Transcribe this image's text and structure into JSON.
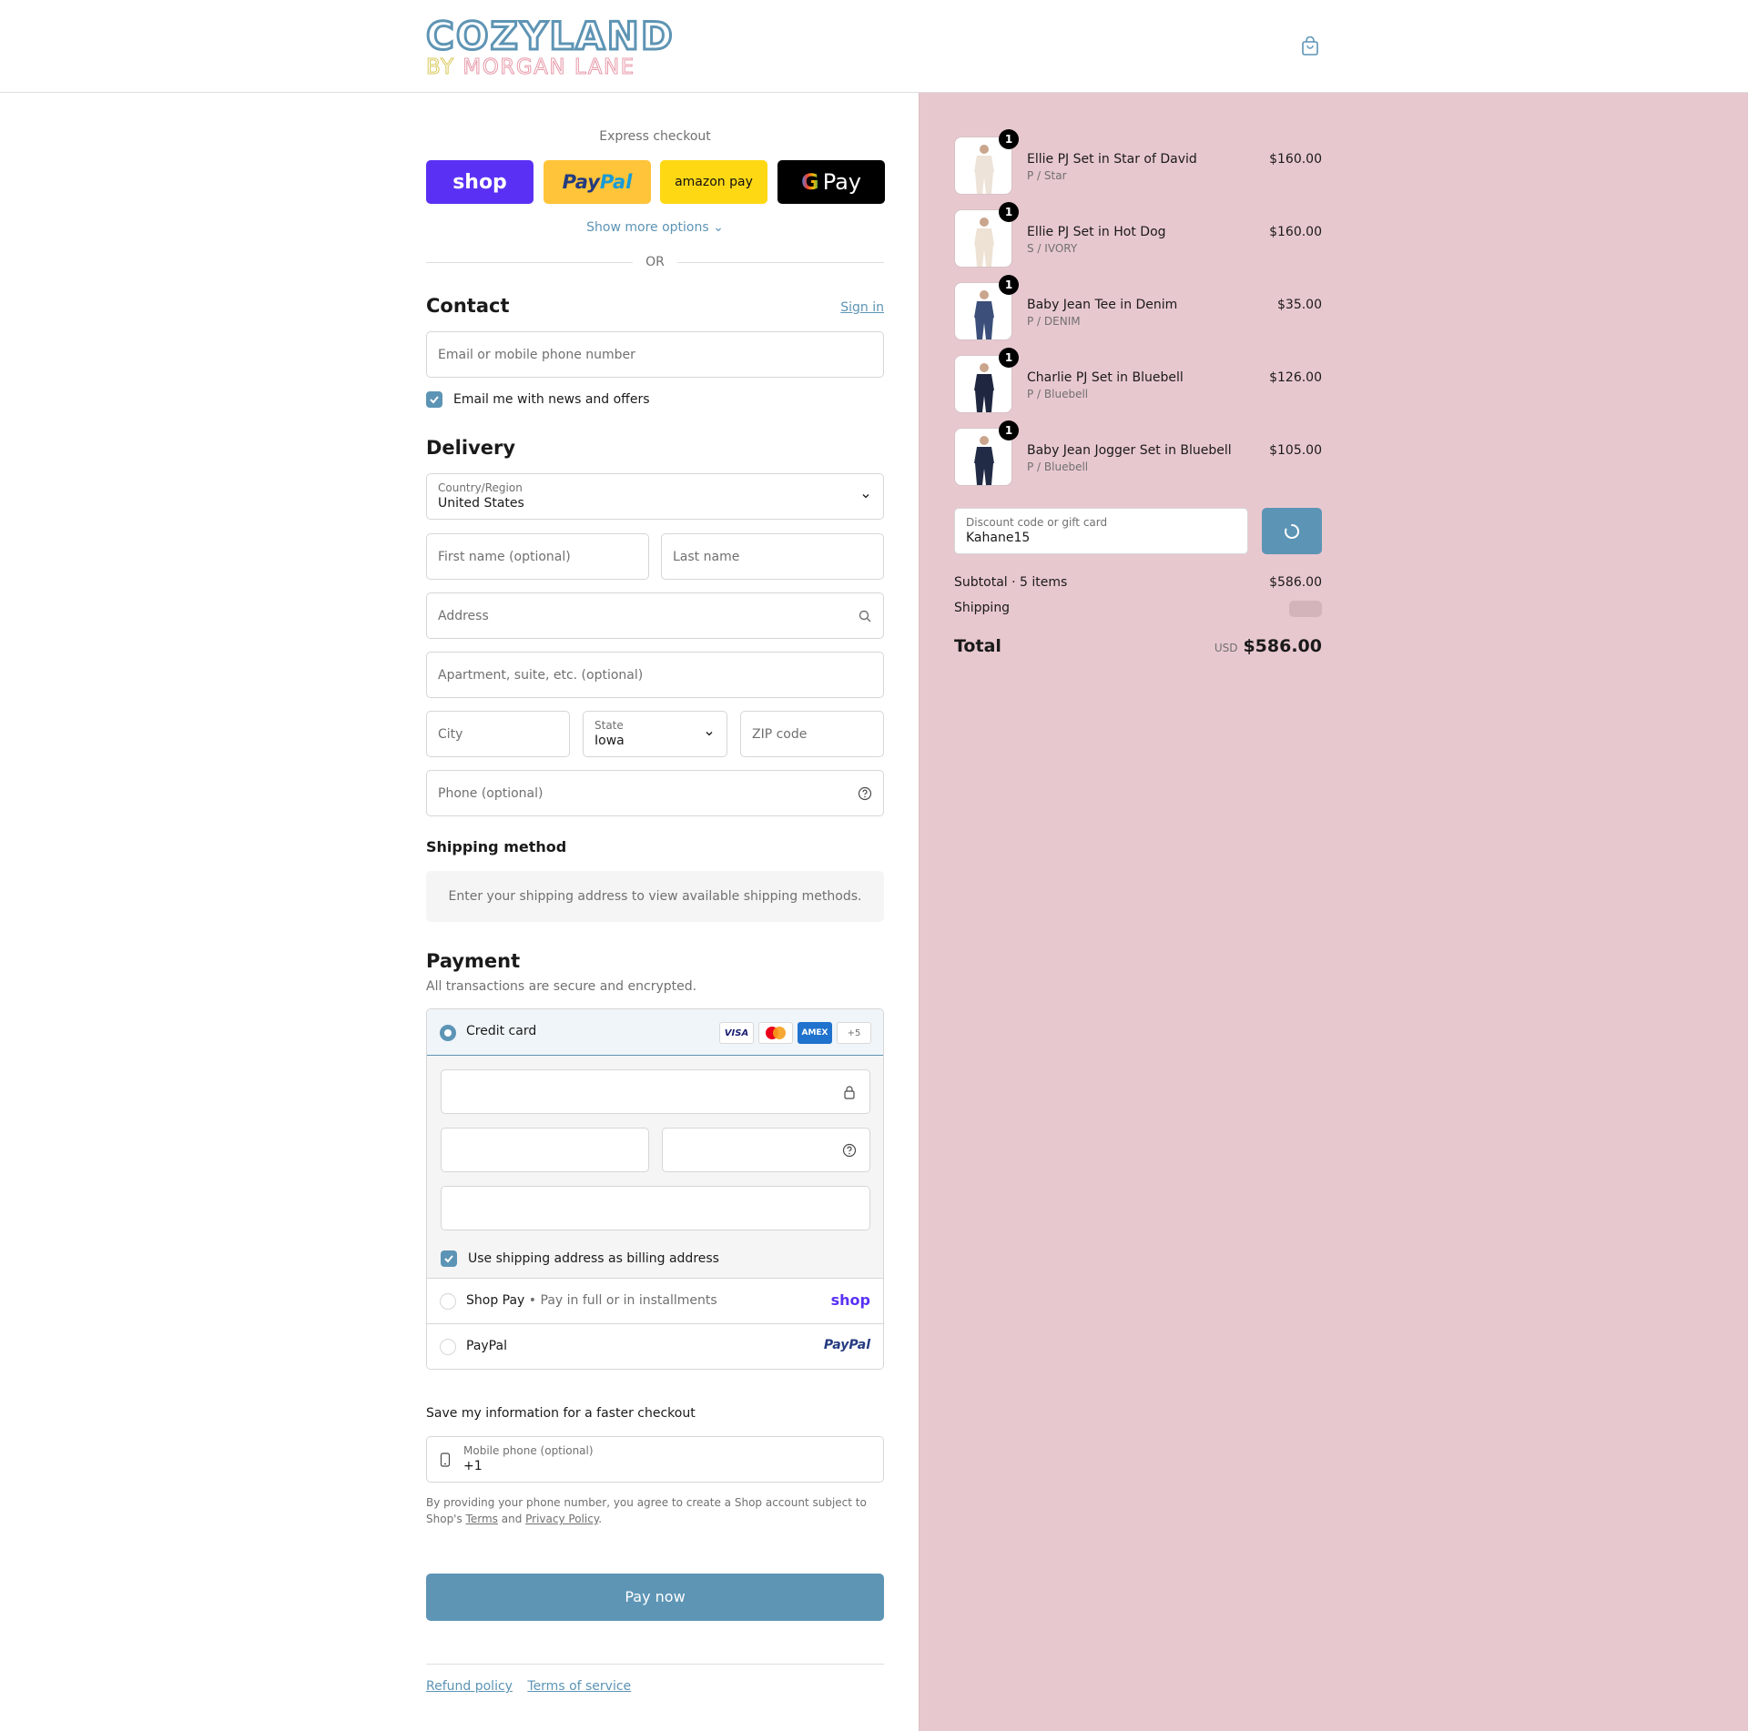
{
  "header": {
    "logo_top": "COZYLAND",
    "logo_by": "BY",
    "logo_bottom": "MORGAN LANE",
    "cart_icon": "bag-icon"
  },
  "express": {
    "title": "Express checkout",
    "shop_label": "shop",
    "paypal_label": "PayPal",
    "amazon_label": "amazon pay",
    "gpay_label": "G Pay",
    "show_more": "Show more options",
    "or": "OR"
  },
  "contact": {
    "title": "Contact",
    "sign_in": "Sign in",
    "email_placeholder": "Email or mobile phone number",
    "news_label": "Email me with news and offers",
    "news_checked": true
  },
  "delivery": {
    "title": "Delivery",
    "country_label": "Country/Region",
    "country_value": "United States",
    "first_name_placeholder": "First name (optional)",
    "last_name_placeholder": "Last name",
    "address_placeholder": "Address",
    "apartment_placeholder": "Apartment, suite, etc. (optional)",
    "city_placeholder": "City",
    "state_label": "State",
    "state_value": "Iowa",
    "zip_placeholder": "ZIP code",
    "phone_placeholder": "Phone (optional)"
  },
  "shipping_method": {
    "title": "Shipping method",
    "message": "Enter your shipping address to view available shipping methods."
  },
  "payment": {
    "title": "Payment",
    "subtitle": "All transactions are secure and encrypted.",
    "credit_card_label": "Credit card",
    "card_logos": [
      "VISA",
      "MC",
      "AMEX"
    ],
    "more_cards": "+5",
    "billing_label": "Use shipping address as billing address",
    "billing_checked": true,
    "shop_pay_label": "Shop Pay",
    "shop_pay_sub": "Pay in full or in installments",
    "shop_pay_logo": "shop",
    "paypal_label": "PayPal",
    "paypal_logo": "PayPal"
  },
  "save_info": {
    "title": "Save my information for a faster checkout",
    "phone_label": "Mobile phone (optional)",
    "phone_value": "+1",
    "legal_text": "By providing your phone number, you agree to create a Shop account subject to Shop's",
    "terms": "Terms",
    "and": "and",
    "privacy": "Privacy Policy",
    "period": "."
  },
  "pay_now": "Pay now",
  "footer": {
    "refund": "Refund policy",
    "terms": "Terms of service"
  },
  "cart": {
    "items": [
      {
        "qty": "1",
        "name": "Ellie PJ Set in Star of David",
        "variant": "P / Star",
        "price": "$160.00",
        "color": "#ede3d8"
      },
      {
        "qty": "1",
        "name": "Ellie PJ Set in Hot Dog",
        "variant": "S / IVORY",
        "price": "$160.00",
        "color": "#ede2d4"
      },
      {
        "qty": "1",
        "name": "Baby Jean Tee in Denim",
        "variant": "P / DENIM",
        "price": "$35.00",
        "color": "#3b4f7a"
      },
      {
        "qty": "1",
        "name": "Charlie PJ Set in Bluebell",
        "variant": "P / Bluebell",
        "price": "$126.00",
        "color": "#1f2740"
      },
      {
        "qty": "1",
        "name": "Baby Jean Jogger Set in Bluebell",
        "variant": "P / Bluebell",
        "price": "$105.00",
        "color": "#222b45"
      }
    ],
    "discount_label": "Discount code or gift card",
    "discount_value": "Kahane15",
    "subtotal_label": "Subtotal · 5 items",
    "subtotal_value": "$586.00",
    "shipping_label": "Shipping",
    "total_label": "Total",
    "currency": "USD",
    "total_value": "$586.00"
  },
  "colors": {
    "accent": "#5c94b5",
    "sidebar_bg": "#e8c8cf",
    "shop_purple": "#5a31f4",
    "paypal_yellow": "#ffc439"
  }
}
